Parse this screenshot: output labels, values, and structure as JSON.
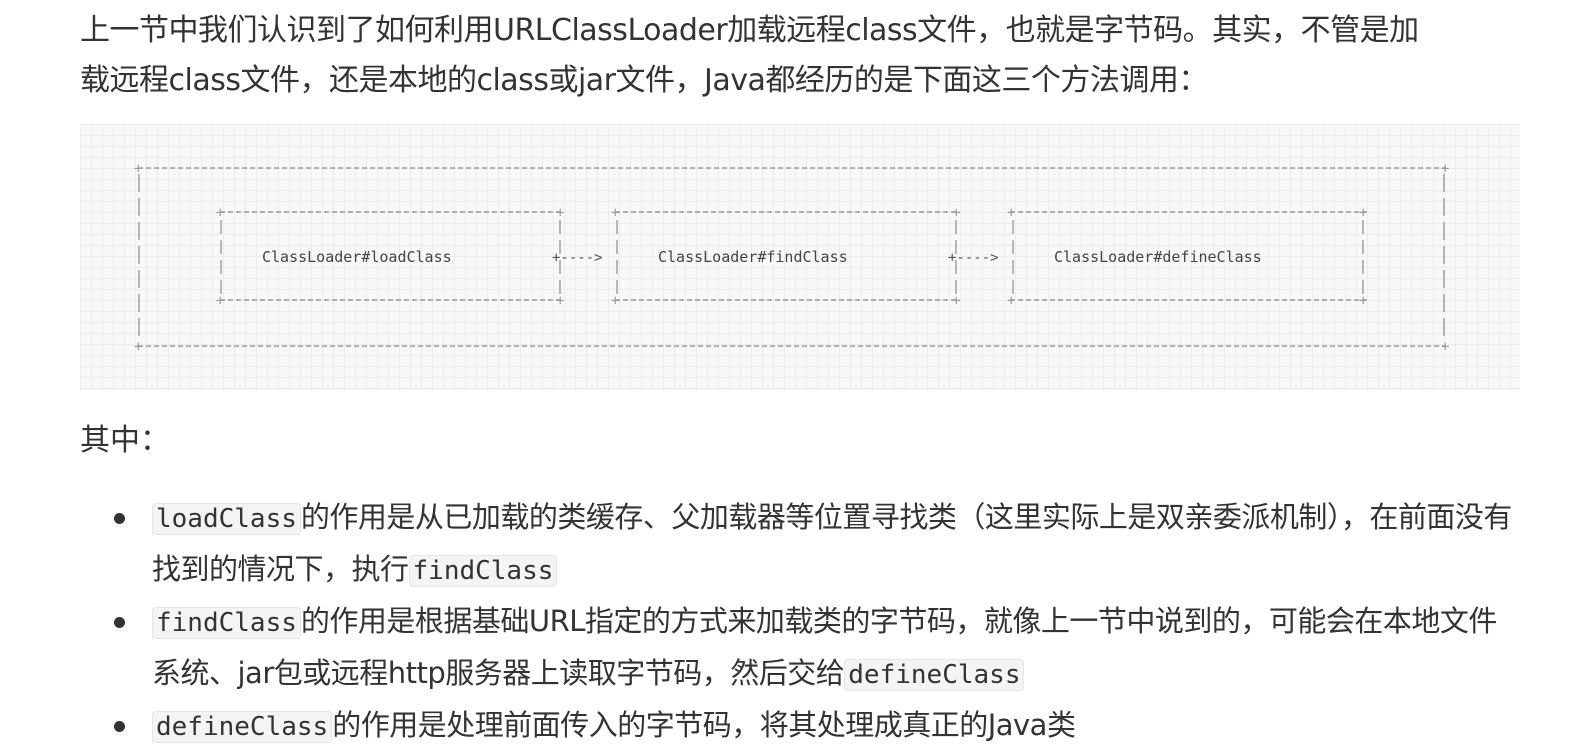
{
  "intro": {
    "line1": "上一节中我们认识到了如何利用URLClassLoader加载远程class文件，也就是字节码。其实，不管是加",
    "line2": "载远程class文件，还是本地的class或jar文件，Java都经历的是下面这三个方法调用："
  },
  "diagram": {
    "boxes": [
      "ClassLoader#loadClass",
      "ClassLoader#findClass",
      "ClassLoader#defineClass"
    ],
    "arrow": "+---->"
  },
  "subheading": "其中：",
  "bullets": [
    {
      "code": "loadClass",
      "text1": "的作用是从已加载的类缓存、父加载器等位置寻找类（这里实际上是双亲委派机制），在前面没有找到的情况下，执行",
      "code2": "findClass"
    },
    {
      "code": "findClass",
      "text1": "的作用是根据基础URL指定的方式来加载类的字节码，就像上一节中说到的，可能会在本地文件系统、jar包或远程http服务器上读取字节码，然后交给",
      "code2": "defineClass"
    },
    {
      "code": "defineClass",
      "text1": "的作用是处理前面传入的字节码，将其处理成真正的Java类"
    }
  ]
}
